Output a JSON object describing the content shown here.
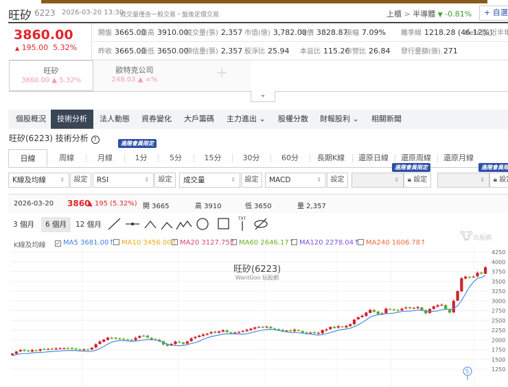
{
  "header": {
    "name": "旺矽",
    "code": "6223",
    "datetime": "2026-03-20 13:30",
    "notice": "成交量僅含一般交易・盤後定價交易",
    "market": "上櫃",
    "sector": "半導體",
    "sector_change": "-0.81%",
    "watchlist_button": "+ 自選股"
  },
  "quote": {
    "price": "3860.00",
    "change": "195.00",
    "change_pct": "5.32%",
    "stats_row1": [
      {
        "label": "開盤",
        "value": "3665.00"
      },
      {
        "label": "最高",
        "value": "3910.00"
      },
      {
        "label": "成交量(張)",
        "value": "2,357"
      },
      {
        "label": "市值(億)",
        "value": "3,782.08"
      },
      {
        "label": "均價",
        "value": "3828.87"
      },
      {
        "label": "振幅",
        "value": "7.09%"
      },
      {
        "label": "離季線",
        "value": "1218.28 (46.12%)"
      },
      {
        "label": "Beta值(近半年)",
        "value": ""
      }
    ],
    "stats_row2": [
      {
        "label": "昨收",
        "value": "3665.00"
      },
      {
        "label": "最低",
        "value": "3650.00"
      },
      {
        "label": "預估量(張)",
        "value": "2,357"
      },
      {
        "label": "股淨比",
        "value": "25.94"
      },
      {
        "label": "本益比",
        "value": "115.26"
      },
      {
        "label": "市營比",
        "value": "26.84"
      },
      {
        "label": "發行量額(億)",
        "value": "271"
      }
    ]
  },
  "compare": [
    {
      "name": "旺矽",
      "price": "3860.00",
      "pct": "5.32%"
    },
    {
      "name": "歐特克公司",
      "price": "248.03",
      "pct": "∞%"
    }
  ],
  "nav": [
    "個股概況",
    "技術分析",
    "法人動態",
    "資券變化",
    "大戶籌碼",
    "主力進出 ⌄",
    "股權分散",
    "財報股利 ⌄",
    "相關新聞"
  ],
  "nav_active": 1,
  "section_title": "旺矽(6223) 技術分析",
  "premium_badge": "進階會員限定",
  "periods": [
    "日線",
    "周線",
    "月線",
    "1分",
    "5分",
    "15分",
    "30分",
    "60分",
    "長期K線",
    "還原日線",
    "還原周線",
    "還原月線"
  ],
  "selects": [
    "K線及均線",
    "RSI",
    "成交量",
    "MACD",
    "",
    ""
  ],
  "settings_label": "設定",
  "info": {
    "date": "2026-03-20",
    "close": "3860",
    "change": "▲ 195 (5.32%)",
    "open": "開 3665",
    "high": "高 3910",
    "low": "低 3650",
    "volume": "量 2,357"
  },
  "ranges": [
    "3 個月",
    "6 個月",
    "12 個月"
  ],
  "range_active": 1,
  "ma_label": "K線及均線",
  "ma": [
    {
      "name": "MA5 3681.00↑",
      "color": "#3f7fe0",
      "checked": true
    },
    {
      "name": "MA10 3456.00↑",
      "color": "#f0a818",
      "checked": false
    },
    {
      "name": "MA20 3127.75↑",
      "color": "#e0407a",
      "checked": false
    },
    {
      "name": "MA60 2646.17↑",
      "color": "#6cb020",
      "checked": false
    },
    {
      "name": "MA120 2278.04↑",
      "color": "#7a4fe0",
      "checked": false
    },
    {
      "name": "MA240 1606.78↑",
      "color": "#f06a3a",
      "checked": false
    }
  ],
  "logo": "玩股網",
  "chart_data": {
    "type": "candlestick",
    "title": "旺矽(6223)",
    "subtitle": "WantGoo 玩股網",
    "ylim": [
      1250,
      4250
    ],
    "yticks": [
      4250,
      4000,
      3750,
      3500,
      3250,
      3000,
      2750,
      2500,
      2250,
      2000,
      1750,
      1500,
      1250
    ],
    "closes": [
      1650,
      1700,
      1740,
      1720,
      1710,
      1740,
      1730,
      1760,
      1750,
      1770,
      1760,
      1780,
      1790,
      1785,
      1790,
      1770,
      1760,
      1740,
      1760,
      1750,
      1800,
      1890,
      1960,
      2010,
      2060,
      2050,
      2030,
      2020,
      2020,
      2010,
      2000,
      2050,
      2100,
      2100,
      2060,
      2010,
      2010,
      1960,
      1880,
      1850,
      1900,
      1960,
      1940,
      1900,
      1960,
      2040,
      2080,
      2110,
      2140,
      2160,
      2200,
      2180,
      2220,
      2250,
      2200,
      2180,
      2190,
      2200,
      2230,
      2260,
      2290,
      2320,
      2330,
      2320,
      2340,
      2300,
      2280,
      2250,
      2220,
      2240,
      2230,
      2260,
      2230,
      2180,
      2160,
      2190,
      2170,
      2180,
      2250,
      2270,
      2330,
      2310,
      2350,
      2330,
      2360,
      2400,
      2520,
      2580,
      2620,
      2700,
      2770,
      2720,
      2660,
      2680,
      2800,
      2790,
      2770,
      2750,
      2800,
      2830,
      2810,
      2820,
      2840,
      2760,
      2680,
      2790,
      2860,
      2890,
      2900,
      2780,
      2700,
      3000,
      3250,
      3580,
      3620,
      3600,
      3620,
      3720,
      3700,
      3860
    ],
    "ma5_shown": true,
    "marker": "5",
    "colors": {
      "up": "#d0222a",
      "down": "#5aaa1e",
      "ma5": "#4a8ae0"
    }
  }
}
